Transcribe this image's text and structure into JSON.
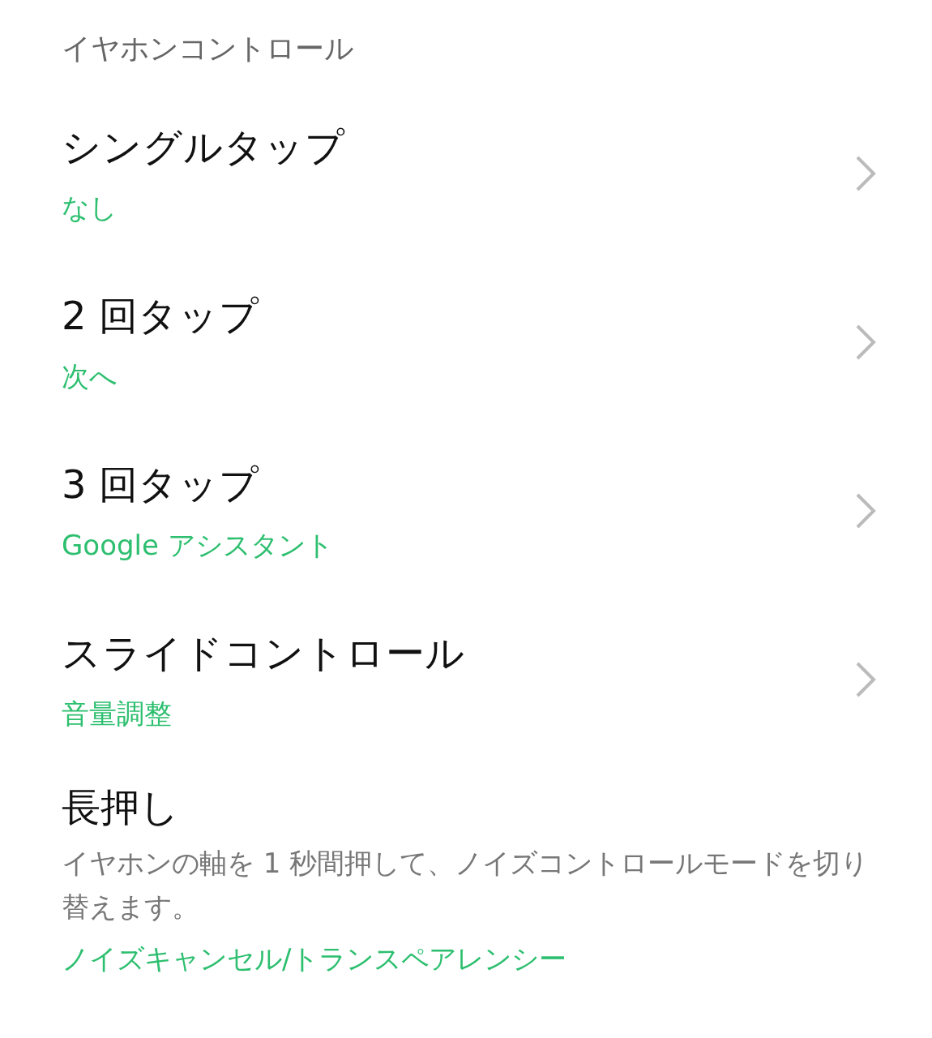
{
  "section_title": "イヤホンコントロール",
  "items": [
    {
      "kind": "nav",
      "title": "シングルタップ",
      "value": "なし"
    },
    {
      "kind": "nav",
      "title": "2 回タップ",
      "value": "次へ"
    },
    {
      "kind": "nav",
      "title": "3 回タップ",
      "value": "Google アシスタント"
    },
    {
      "kind": "nav",
      "title": "スライドコントロール",
      "value": "音量調整"
    },
    {
      "kind": "info",
      "title": "長押し",
      "description": "イヤホンの軸を 1 秒間押して、ノイズコントロールモードを切り替えます。",
      "value": "ノイズキャンセル/トランスペアレンシー"
    }
  ]
}
